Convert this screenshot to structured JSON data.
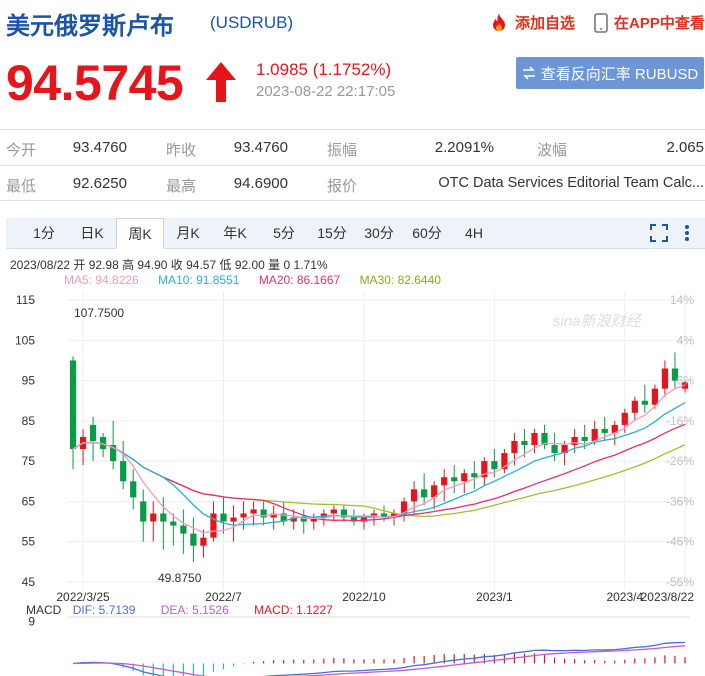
{
  "header": {
    "title": "美元俄罗斯卢布",
    "code": "(USDRUB)",
    "add_label": "添加自选",
    "app_label": "在APP中查看"
  },
  "quote": {
    "price": "94.5745",
    "change": "1.0985 (1.1752%)",
    "time": "2023-08-22 22:17:05",
    "reverse_label": "查看反向汇率 RUBUSD",
    "colors": {
      "up": "#e5161b",
      "down": "#0a9b45",
      "brand": "#1a55a8"
    }
  },
  "stats": [
    [
      {
        "label": "今开",
        "value": "93.4760"
      },
      {
        "label": "昨收",
        "value": "93.4760"
      },
      {
        "label": "振幅",
        "value": "2.2091%"
      },
      {
        "label": "波幅",
        "value": "2.065"
      }
    ],
    [
      {
        "label": "最低",
        "value": "92.6250"
      },
      {
        "label": "最高",
        "value": "94.6900"
      },
      {
        "label": "报价",
        "value": "OTC Data Services Editorial Team Calc..."
      }
    ]
  ],
  "tabs": [
    "1分",
    "日K",
    "周K",
    "月K",
    "年K",
    "5分",
    "15分",
    "30分",
    "60分",
    "4H"
  ],
  "active_tab": "周K",
  "legend": {
    "ohlc": "2023/08/22 开 92.98 高 94.90 收 94.57 低 92.00 量 0 1.71%",
    "ma5": "MA5: 94.8226",
    "ma10": "MA10: 91.8551",
    "ma20": "MA20: 86.1667",
    "ma30": "MA30: 82.6440",
    "macd": "MACD",
    "dif": "DIF: 5.7139",
    "dea": "DEA: 5.1526",
    "macd_val": "MACD: 1.1227"
  },
  "watermark": "sina新浪财经",
  "chart_data": {
    "type": "candlestick",
    "y_ticks": [
      115,
      105,
      95,
      85,
      75,
      65,
      55,
      45
    ],
    "ylim": [
      43,
      117
    ],
    "pct_ticks": [
      "14%",
      "4%",
      "-6%",
      "-16%",
      "-26%",
      "-36%",
      "-46%",
      "-56%"
    ],
    "x_ticks": [
      "2022/3/25",
      "2022/7",
      "2022/10",
      "2023/1",
      "2023/4",
      "2023/8/22"
    ],
    "annotations": {
      "max": "107.7500",
      "min": "49.8750"
    },
    "ma_colors": {
      "ma5": "#f09cba",
      "ma10": "#25b3d4",
      "ma20": "#e5306a",
      "ma30": "#a4bd2c"
    },
    "candles": [
      [
        100,
        101,
        73,
        78
      ],
      [
        78,
        83,
        74,
        81
      ],
      [
        84,
        86,
        75,
        80
      ],
      [
        81,
        82,
        76,
        78
      ],
      [
        79,
        85,
        73,
        75
      ],
      [
        75,
        80,
        68,
        70
      ],
      [
        70,
        73,
        63,
        66
      ],
      [
        65,
        68,
        55,
        60
      ],
      [
        60,
        65,
        55,
        62
      ],
      [
        62,
        66,
        53,
        60
      ],
      [
        60,
        62,
        54,
        59
      ],
      [
        59,
        63,
        52,
        57
      ],
      [
        57,
        61,
        49.9,
        54
      ],
      [
        54,
        58,
        51,
        56
      ],
      [
        56,
        65,
        55,
        62
      ],
      [
        62,
        66,
        57,
        60
      ],
      [
        60,
        64,
        55,
        61
      ],
      [
        61,
        65,
        58,
        62
      ],
      [
        62,
        65,
        59,
        63
      ],
      [
        63,
        65,
        59,
        61
      ],
      [
        61,
        64,
        58,
        62
      ],
      [
        62,
        65,
        59,
        60
      ],
      [
        60,
        63,
        58,
        61
      ],
      [
        61,
        63,
        57,
        60
      ],
      [
        60,
        62,
        58,
        61
      ],
      [
        61,
        63,
        59,
        62
      ],
      [
        62,
        64,
        60,
        63
      ],
      [
        63,
        64,
        60,
        61
      ],
      [
        61,
        63,
        59,
        60
      ],
      [
        60,
        62,
        58,
        61
      ],
      [
        61,
        63,
        59,
        62
      ],
      [
        62,
        64,
        60,
        61
      ],
      [
        61,
        63,
        59,
        62
      ],
      [
        62,
        66,
        60,
        65
      ],
      [
        65,
        70,
        62,
        68
      ],
      [
        68,
        72,
        64,
        66
      ],
      [
        66,
        70,
        63,
        69
      ],
      [
        69,
        73,
        65,
        71
      ],
      [
        71,
        74,
        67,
        70
      ],
      [
        70,
        73,
        67,
        72
      ],
      [
        72,
        75,
        68,
        71
      ],
      [
        71,
        76,
        69,
        75
      ],
      [
        75,
        78,
        71,
        73
      ],
      [
        73,
        78,
        72,
        77
      ],
      [
        77,
        82,
        74,
        80
      ],
      [
        80,
        83,
        76,
        79
      ],
      [
        79,
        83,
        77,
        82
      ],
      [
        82,
        84,
        78,
        79
      ],
      [
        79,
        82,
        75,
        77
      ],
      [
        77,
        80,
        74,
        79
      ],
      [
        79,
        83,
        77,
        81
      ],
      [
        81,
        84,
        78,
        80
      ],
      [
        80,
        85,
        79,
        83
      ],
      [
        83,
        86,
        80,
        82
      ],
      [
        82,
        85,
        79,
        84
      ],
      [
        84,
        88,
        82,
        87
      ],
      [
        87,
        91,
        85,
        90
      ],
      [
        90,
        94,
        87,
        89
      ],
      [
        89,
        94,
        88,
        93
      ],
      [
        93,
        100,
        91,
        98
      ],
      [
        98,
        102,
        93,
        95
      ],
      [
        92.98,
        94.9,
        92.0,
        94.57
      ]
    ],
    "macd_ylim": [
      -7,
      10
    ],
    "macd_tick": "9"
  }
}
